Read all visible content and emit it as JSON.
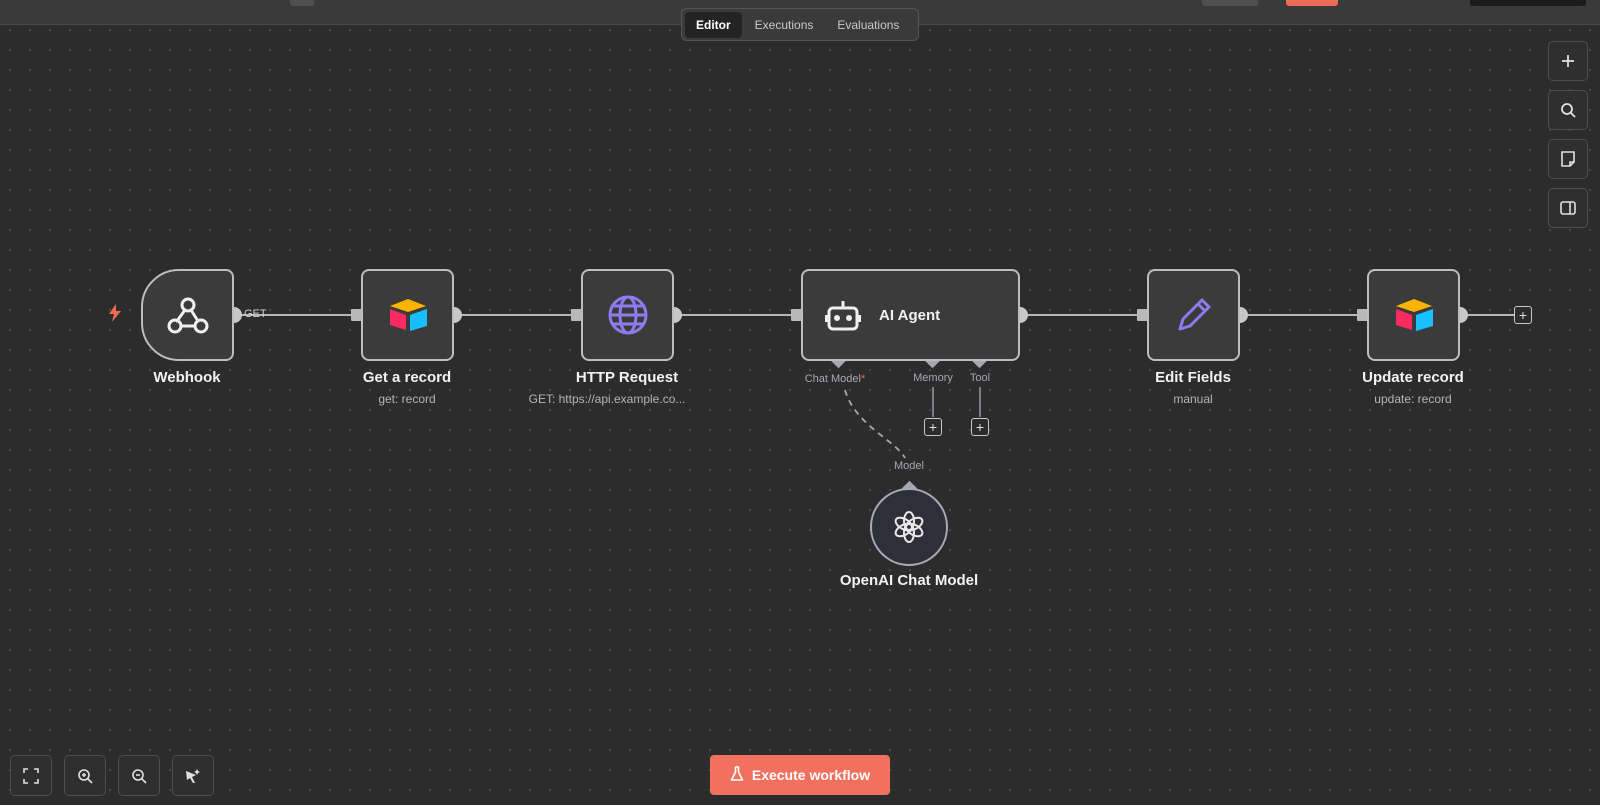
{
  "tabs": [
    {
      "label": "Editor",
      "active": true
    },
    {
      "label": "Executions",
      "active": false
    },
    {
      "label": "Evaluations",
      "active": false
    }
  ],
  "nodes": {
    "webhook": {
      "title": "Webhook",
      "icon": "webhook-icon"
    },
    "get_record": {
      "title": "Get a record",
      "subtitle": "get: record",
      "icon": "airtable-icon"
    },
    "http_request": {
      "title": "HTTP Request",
      "subtitle": "GET: https://api.example.co...",
      "icon": "globe-icon"
    },
    "ai_agent": {
      "title": "AI Agent",
      "icon": "robot-icon"
    },
    "edit_fields": {
      "title": "Edit Fields",
      "subtitle": "manual",
      "icon": "pencil-icon"
    },
    "update_record": {
      "title": "Update record",
      "subtitle": "update: record",
      "icon": "airtable-icon"
    },
    "openai_model": {
      "title": "OpenAI Chat Model",
      "icon": "openai-icon"
    }
  },
  "edge_labels": {
    "webhook_out": "GET"
  },
  "agent_ports": {
    "chat_model": "Chat Model",
    "chat_model_required": "*",
    "memory": "Memory",
    "tool": "Tool"
  },
  "model_port_label": "Model",
  "execute_button": {
    "label": "Execute workflow",
    "icon": "flask-icon"
  },
  "right_toolbar": [
    "plus-icon",
    "search-icon",
    "sticky-note-icon",
    "panel-icon"
  ],
  "bottom_toolbar": [
    "fit-view-icon",
    "zoom-in-icon",
    "zoom-out-icon",
    "tidy-up-icon"
  ],
  "colors": {
    "accent": "#ee6b57",
    "canvas": "#2c2c2c",
    "node_bg": "#3b3b3b",
    "node_border": "#bdbdbd",
    "icon_purple": "#8c7cf0"
  }
}
